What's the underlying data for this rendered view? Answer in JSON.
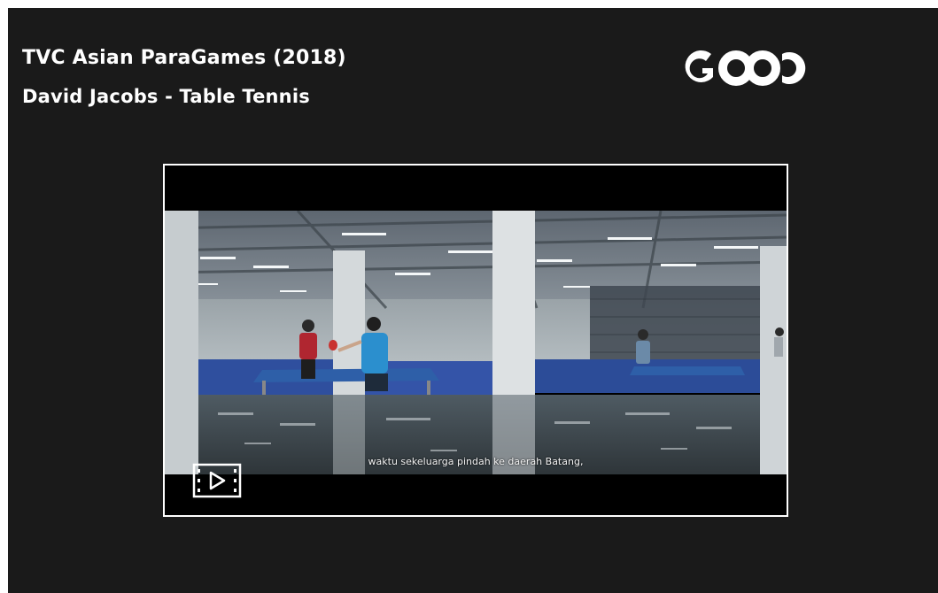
{
  "slide": {
    "title": "TVC Asian ParaGames (2018)",
    "subtitle": "David Jacobs - Table Tennis",
    "logo_text": "GOOD"
  },
  "video": {
    "caption": "waktu sekeluarga pindah ke daerah Batang,",
    "play_icon": "film-play-icon"
  },
  "colors": {
    "background": "#1a1a1a",
    "text": "#ffffff",
    "video_border": "#ffffff",
    "letterbox": "#000000"
  }
}
